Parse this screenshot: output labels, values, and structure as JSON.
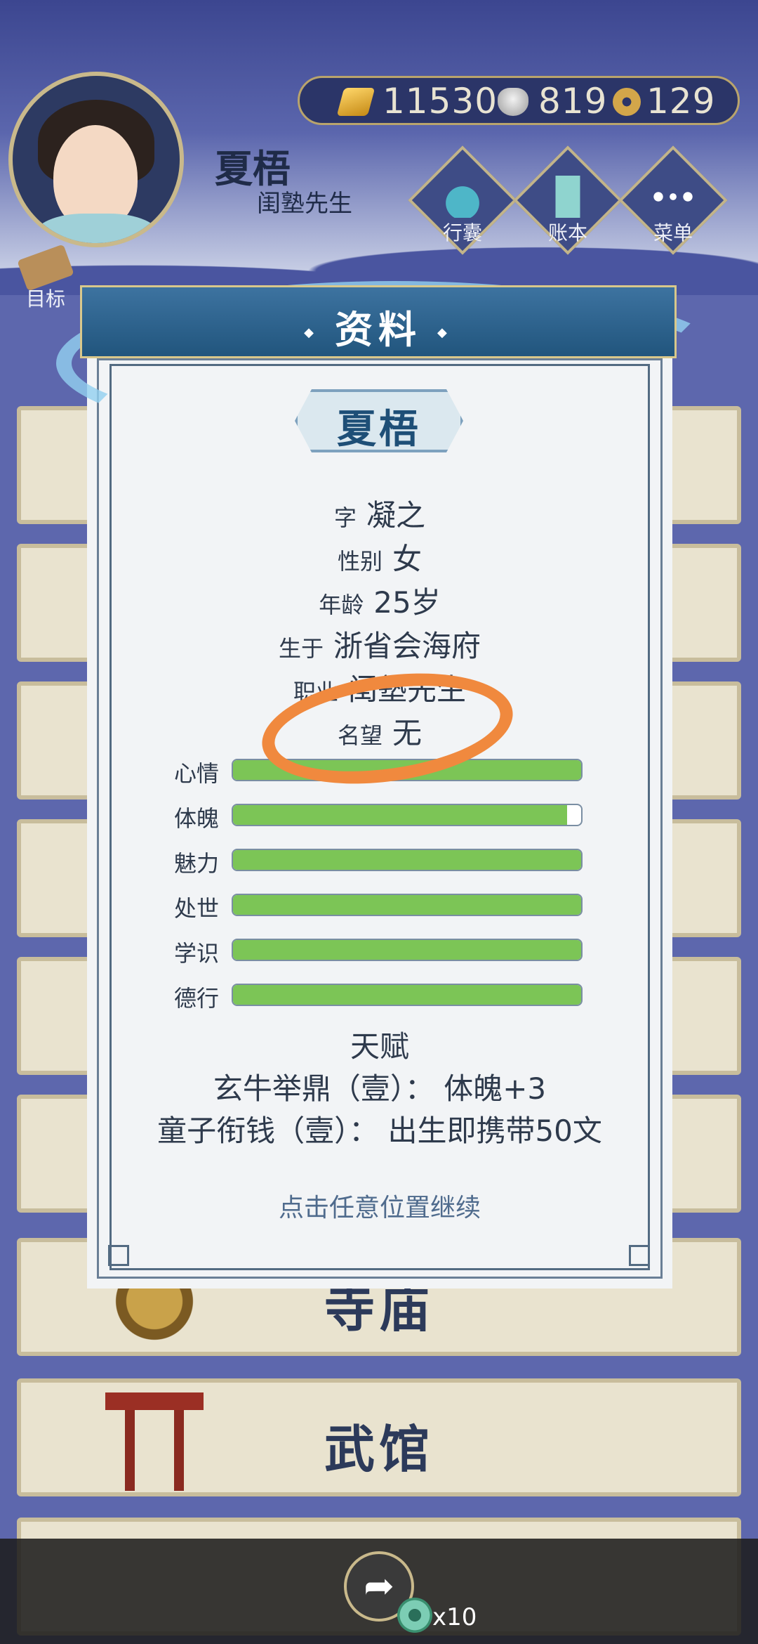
{
  "player": {
    "name": "夏梧",
    "title": "闺塾先生"
  },
  "currency": {
    "gold": "11530",
    "silver": "819",
    "coin": "129"
  },
  "hud": {
    "bag_label": "行囊",
    "ledger_label": "账本",
    "menu_label": "菜单",
    "target_label": "目标"
  },
  "list": {
    "temple": "寺庙",
    "dojo": "武馆"
  },
  "dialog": {
    "title": "资料",
    "name": "夏梧",
    "rows": [
      {
        "key": "字",
        "value": "凝之"
      },
      {
        "key": "性别",
        "value": "女"
      },
      {
        "key": "年龄",
        "value": "25岁"
      },
      {
        "key": "生于",
        "value": "浙省会海府"
      },
      {
        "key": "职业",
        "value": "闺塾先生"
      },
      {
        "key": "名望",
        "value": "无"
      }
    ],
    "stats": [
      {
        "label": "心情",
        "fill": 1.0
      },
      {
        "label": "体魄",
        "fill": 0.96
      },
      {
        "label": "魅力",
        "fill": 1.0
      },
      {
        "label": "处世",
        "fill": 1.0
      },
      {
        "label": "学识",
        "fill": 1.0
      },
      {
        "label": "德行",
        "fill": 1.0
      }
    ],
    "talent_heading": "天赋",
    "talents": [
      "玄牛举鼎（壹）： 体魄+3",
      "童子衔钱（壹）： 出生即携带50文"
    ],
    "continue_hint": "点击任意位置继续"
  },
  "bottom": {
    "token_count": "x10"
  },
  "colors": {
    "stat_fill": "#7cc556",
    "annotation": "#f0893e",
    "header_blue": "#21557d"
  }
}
